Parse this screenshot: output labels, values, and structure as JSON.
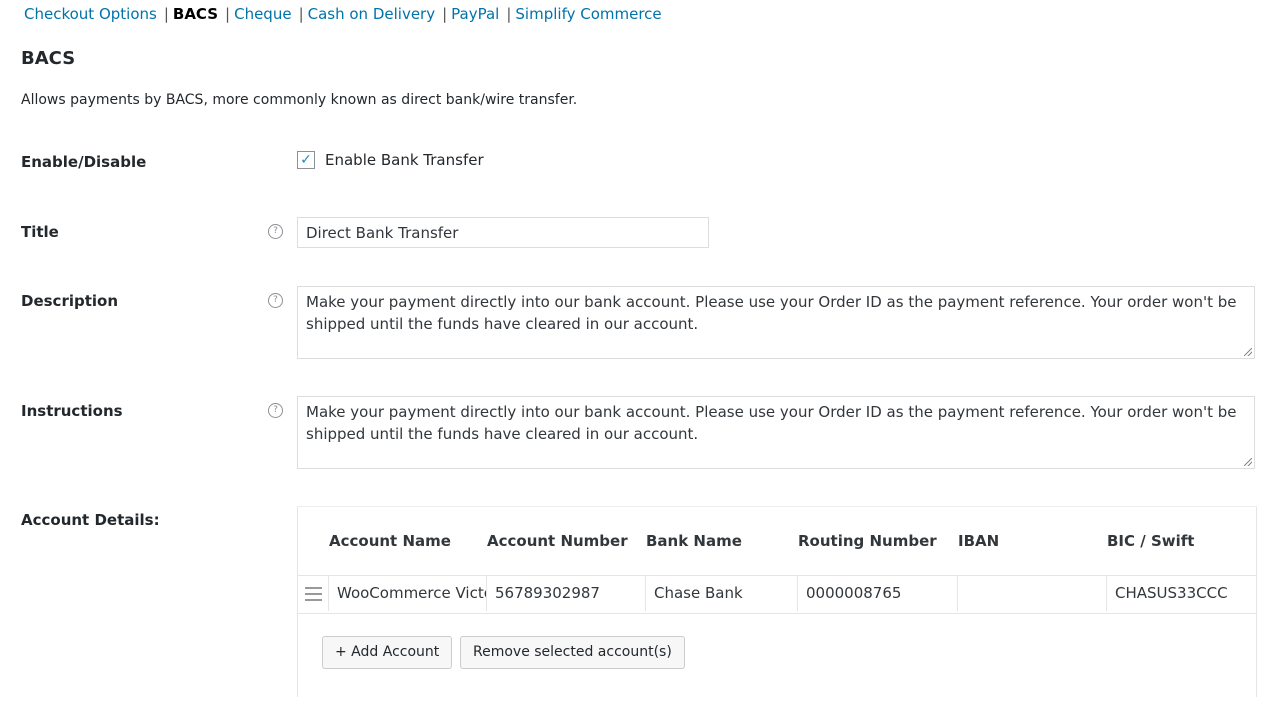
{
  "nav": {
    "items": [
      "Checkout Options",
      "BACS",
      "Cheque",
      "Cash on Delivery",
      "PayPal",
      "Simplify Commerce"
    ],
    "separator": "|"
  },
  "page": {
    "title": "BACS",
    "description": "Allows payments by BACS, more commonly known as direct bank/wire transfer."
  },
  "fields": {
    "enable": {
      "label": "Enable/Disable",
      "checkbox_label": "Enable Bank Transfer",
      "checked": true
    },
    "title": {
      "label": "Title",
      "value": "Direct Bank Transfer"
    },
    "description": {
      "label": "Description",
      "value": "Make your payment directly into our bank account. Please use your Order ID as the payment reference. Your order won't be shipped until the funds have cleared in our account."
    },
    "instructions": {
      "label": "Instructions",
      "value": "Make your payment directly into our bank account. Please use your Order ID as the payment reference. Your order won't be shipped until the funds have cleared in our account."
    }
  },
  "accounts": {
    "label": "Account Details:",
    "headers": [
      "Account Name",
      "Account Number",
      "Bank Name",
      "Routing Number",
      "IBAN",
      "BIC / Swift"
    ],
    "rows": [
      [
        "WooCommerce Victor",
        "56789302987",
        "Chase Bank",
        "0000008765",
        "",
        "CHASUS33CCC"
      ]
    ],
    "add_label": "+ Add Account",
    "remove_label": "Remove selected account(s)"
  },
  "icons": {
    "help": "question-circle-icon",
    "check": "checkmark-icon",
    "drag": "drag-handle-icon"
  },
  "colors": {
    "link": "#0073aa",
    "check": "#1e8cbe"
  }
}
